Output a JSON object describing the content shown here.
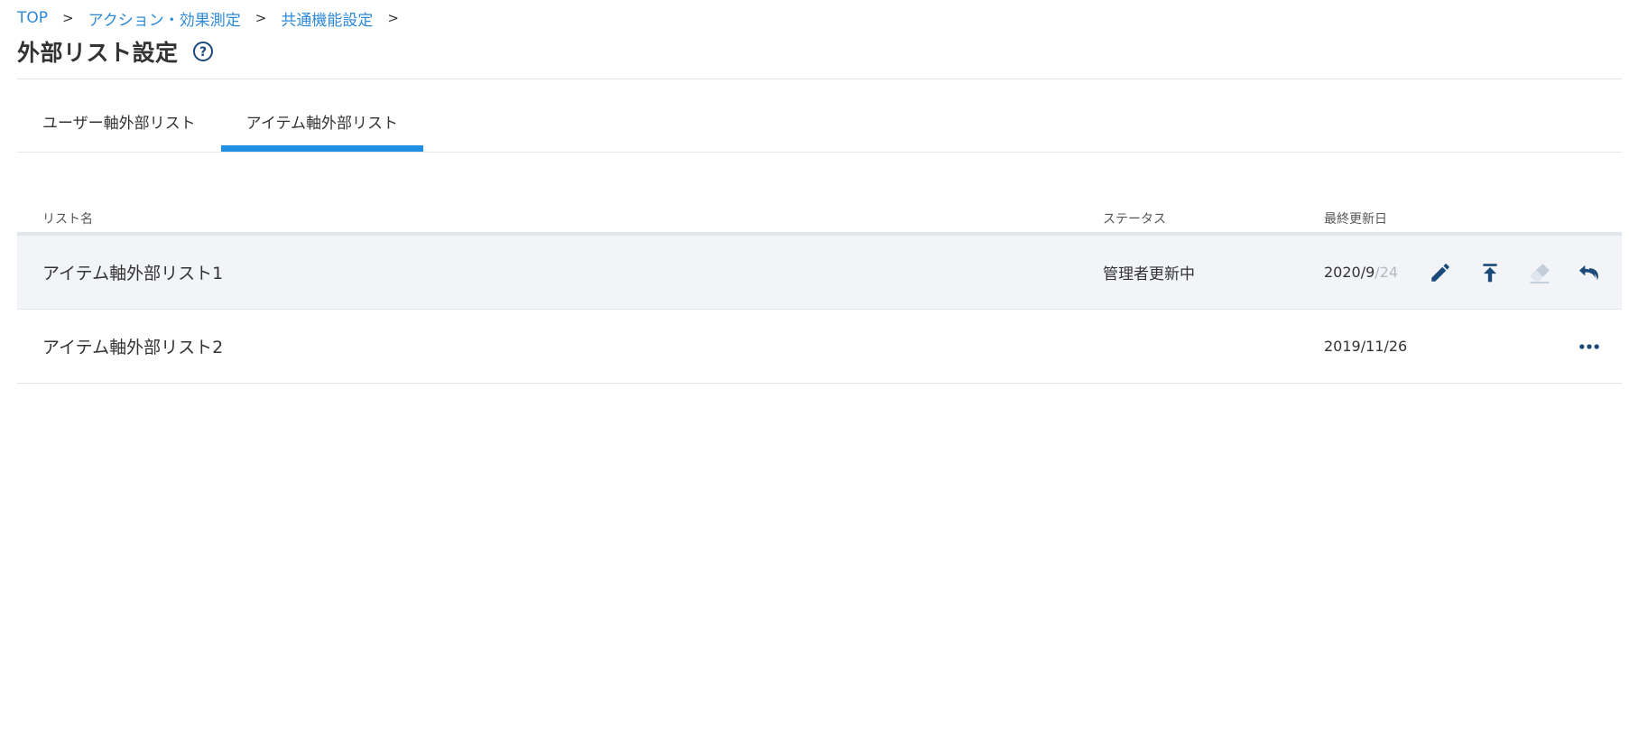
{
  "breadcrumb": {
    "items": [
      "TOP",
      "アクション・効果測定",
      "共通機能設定"
    ],
    "separator": ">"
  },
  "page": {
    "title": "外部リスト設定",
    "help_icon": "question-circle-icon"
  },
  "tabs": [
    {
      "label": "ユーザー軸外部リスト",
      "active": false
    },
    {
      "label": "アイテム軸外部リスト",
      "active": true
    }
  ],
  "table": {
    "headers": {
      "name": "リスト名",
      "status": "ステータス",
      "updated": "最終更新日"
    },
    "rows": [
      {
        "name": "アイテム軸外部リスト1",
        "status": "管理者更新中",
        "date_main": "2020/9",
        "date_faded": "/24",
        "actions": [
          "pencil-icon",
          "upload-icon",
          "eraser-icon",
          "undo-icon"
        ]
      },
      {
        "name": "アイテム軸外部リスト2",
        "status": "",
        "date_main": "2019/11/26",
        "date_faded": "",
        "actions": [
          "more-horizontal-icon"
        ]
      }
    ]
  },
  "colors": {
    "accent": "#1f90e6",
    "link": "#2e8ad8",
    "icon": "#1b4a7a",
    "icon_disabled": "#b8c4d2",
    "hover_row": "#f2f4f7"
  }
}
